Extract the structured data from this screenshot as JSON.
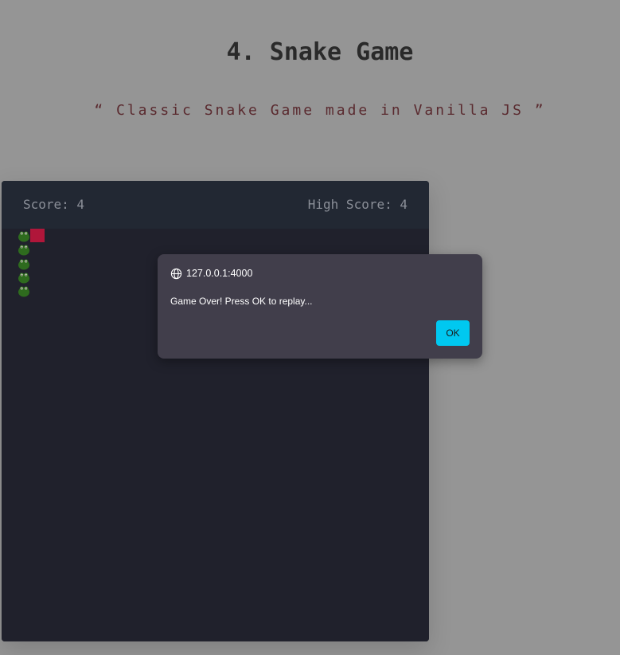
{
  "page": {
    "title": "4. Snake Game",
    "subtitle": "“ Classic Snake Game made in Vanilla JS ”"
  },
  "game": {
    "score_label": "Score: 4",
    "high_score_label": "High Score: 4",
    "snake_length": 5,
    "colors": {
      "board": "#20212c",
      "header": "#222833",
      "food": "#b0163a",
      "snake": "#2e6b1e"
    }
  },
  "alert": {
    "origin": "127.0.0.1:4000",
    "message": "Game Over! Press OK to replay...",
    "ok_label": "OK",
    "accent": "#00c8f0"
  }
}
